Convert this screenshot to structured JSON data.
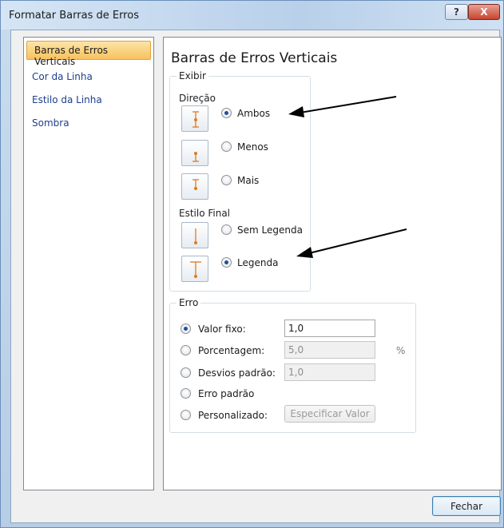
{
  "window": {
    "title": "Formatar Barras de Erros",
    "help_label": "?",
    "close_label": "X"
  },
  "nav": {
    "items": [
      {
        "label": "Barras de Erros Verticais",
        "selected": true
      },
      {
        "label": "Cor da Linha"
      },
      {
        "label": "Estilo da Linha"
      },
      {
        "label": "Sombra"
      }
    ]
  },
  "panel": {
    "title": "Barras de Erros Verticais",
    "exibir": {
      "group_label": "Exibir",
      "direcao_label": "Direção",
      "direcao_options": [
        {
          "label": "Ambos",
          "checked": true,
          "icon": "error-bar-both-icon"
        },
        {
          "label": "Menos",
          "checked": false,
          "icon": "error-bar-minus-icon"
        },
        {
          "label": "Mais",
          "checked": false,
          "icon": "error-bar-plus-icon"
        }
      ],
      "estilo_label": "Estilo Final",
      "estilo_options": [
        {
          "label": "Sem Legenda",
          "checked": false,
          "icon": "error-bar-no-cap-icon"
        },
        {
          "label": "Legenda",
          "checked": true,
          "icon": "error-bar-cap-icon"
        }
      ]
    },
    "erro": {
      "group_label": "Erro",
      "options": [
        {
          "label": "Valor fixo:",
          "checked": true,
          "value": "1,0",
          "enabled": true
        },
        {
          "label": "Porcentagem:",
          "checked": false,
          "value": "5,0",
          "enabled": false,
          "suffix": "%"
        },
        {
          "label": "Desvios padrão:",
          "checked": false,
          "value": "1,0",
          "enabled": false
        },
        {
          "label": "Erro padrão",
          "checked": false
        },
        {
          "label": "Personalizado:",
          "checked": false,
          "button": "Especificar Valor"
        }
      ]
    }
  },
  "footer": {
    "close_button": "Fechar"
  },
  "colors": {
    "accent_orange": "#e07a1f",
    "selection": "#f7c25f",
    "arrow": "#000000"
  }
}
